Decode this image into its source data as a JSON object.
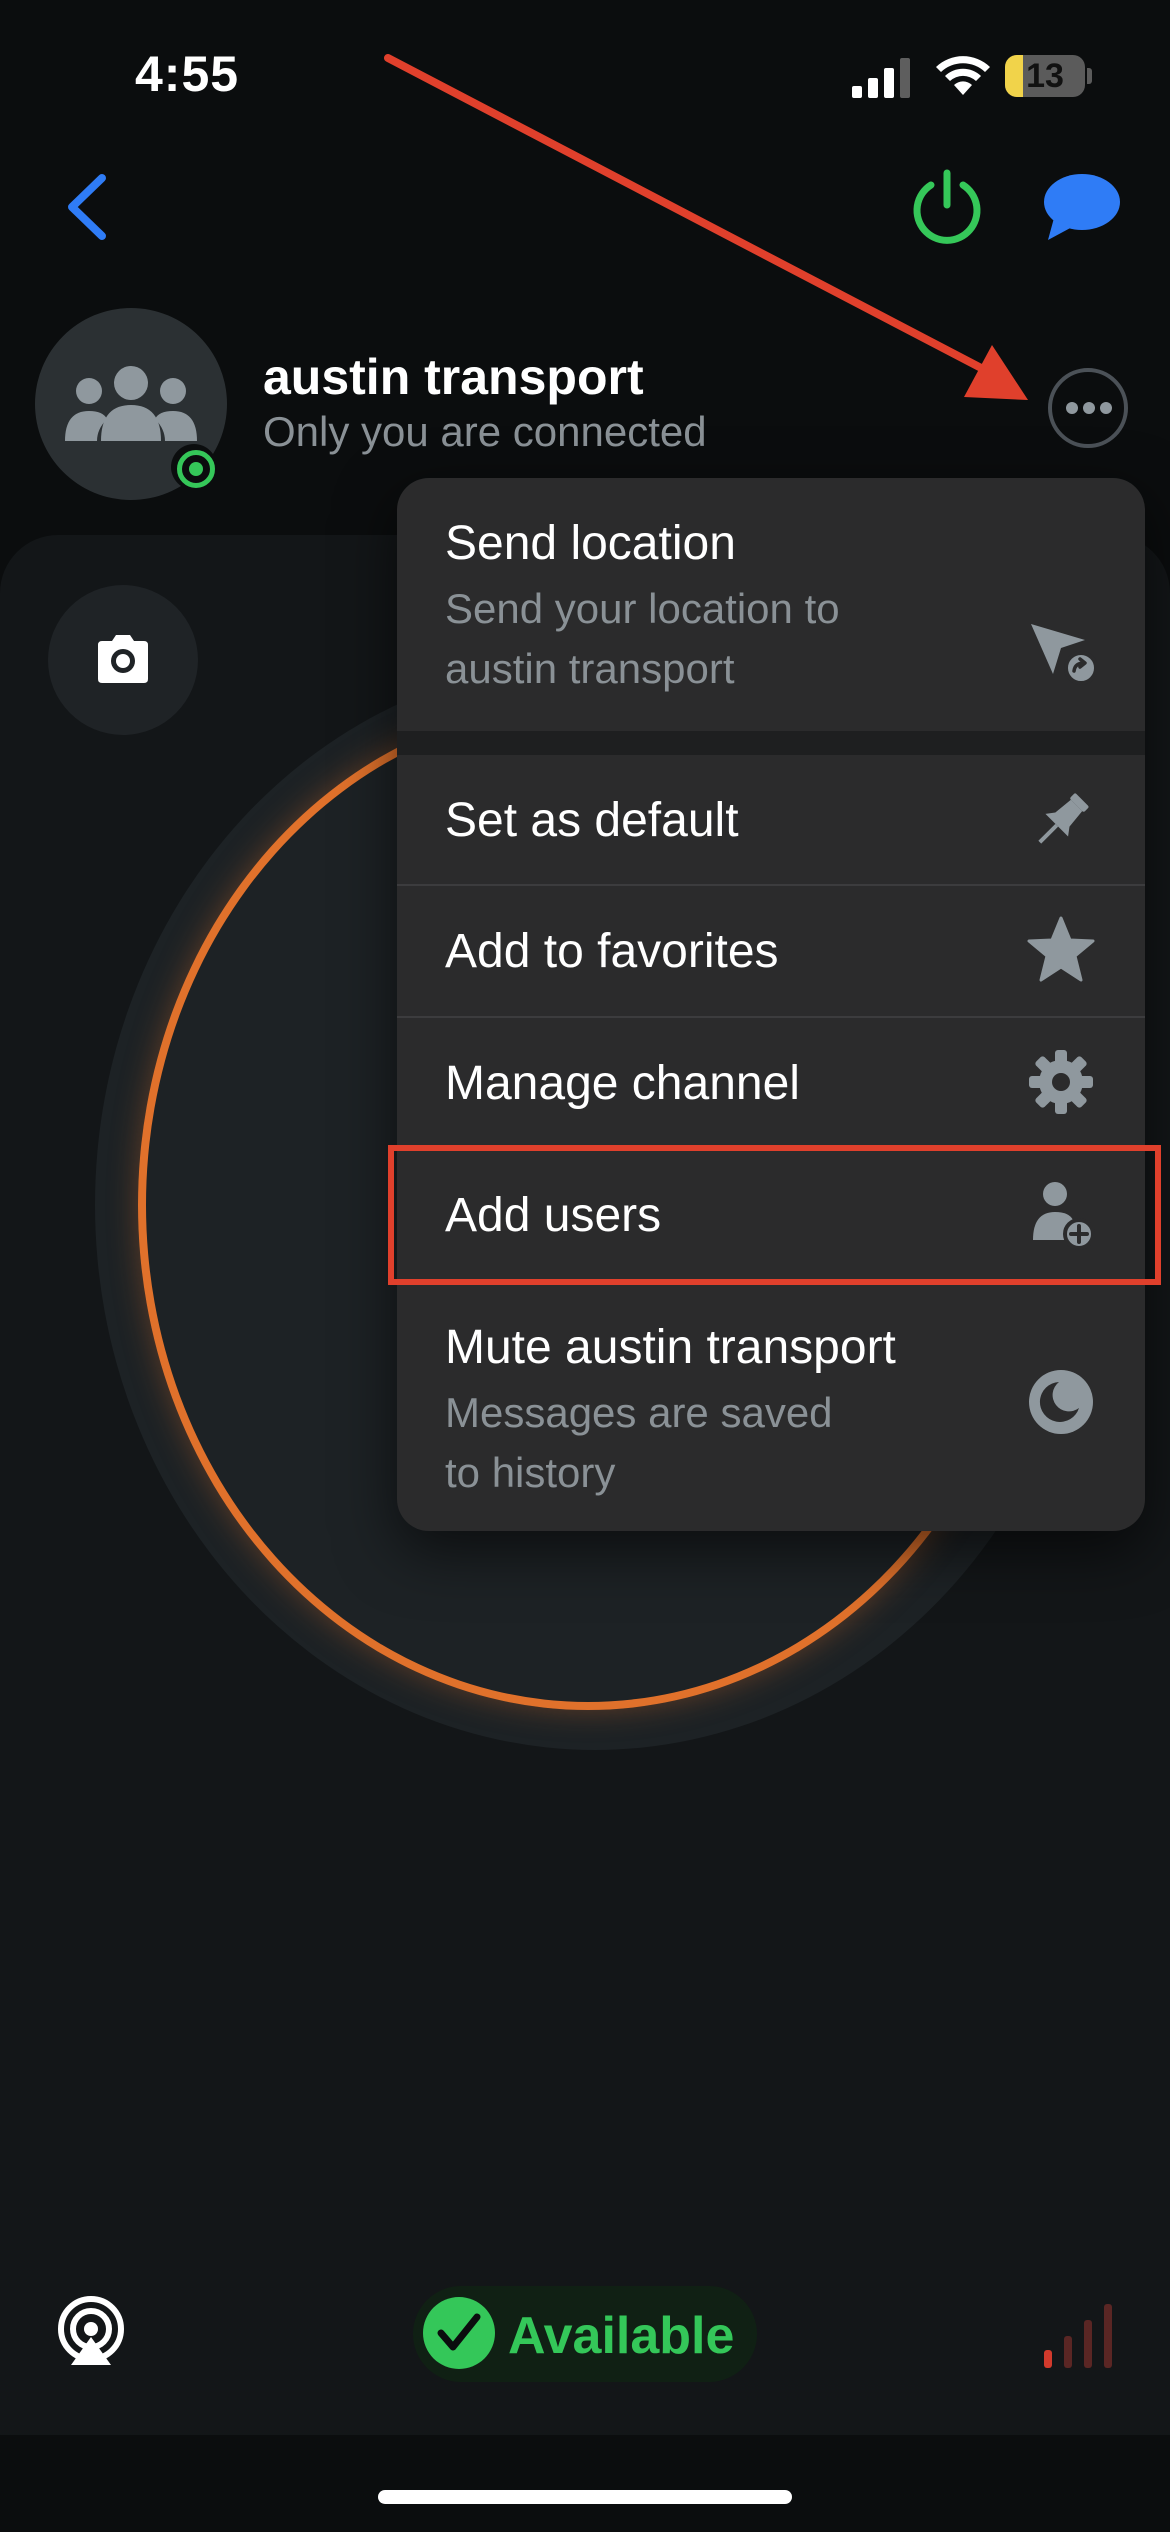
{
  "status_bar": {
    "time": "4:55",
    "battery": "13"
  },
  "channel": {
    "title": "austin transport",
    "subtitle": "Only you are connected"
  },
  "menu": {
    "items": [
      {
        "label": "Send location",
        "sub1": "Send your location to",
        "sub2": "austin transport",
        "icon": "send-location-icon"
      },
      {
        "label": "Set as default",
        "icon": "pin-icon"
      },
      {
        "label": "Add to favorites",
        "icon": "star-icon"
      },
      {
        "label": "Manage channel",
        "icon": "gear-icon"
      },
      {
        "label": "Add users",
        "icon": "add-user-icon"
      },
      {
        "label": "Mute austin transport",
        "sub1": "Messages are saved",
        "sub2": "to history",
        "icon": "moon-icon"
      }
    ]
  },
  "bottom": {
    "status": "Available"
  },
  "colors": {
    "accent_blue": "#2f7cf6",
    "power_green": "#35c759",
    "ring_orange": "#e0712b",
    "annotation_red": "#e0402c"
  }
}
